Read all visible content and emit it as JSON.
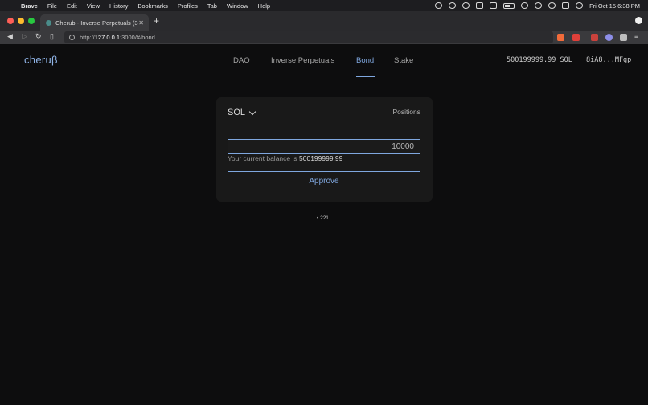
{
  "menubar": {
    "app": "Brave",
    "items": [
      "File",
      "Edit",
      "View",
      "History",
      "Bookmarks",
      "Profiles",
      "Tab",
      "Window",
      "Help"
    ],
    "clock": "Fri Oct 15  6:38 PM"
  },
  "tab": {
    "title": "Cherub - Inverse Perpetuals (3..."
  },
  "toolbar": {
    "url_scheme": "http://",
    "url_host": "127.0.0.1",
    "url_rest": ":3000/#/bond"
  },
  "header": {
    "logo": "cheruβ",
    "nav": [
      "DAO",
      "Inverse Perpetuals",
      "Bond",
      "Stake"
    ],
    "active_nav": "Bond",
    "balance": "500199999.99 SOL",
    "wallet": "8iA8...MFgp"
  },
  "card": {
    "token": "SOL",
    "positions_label": "Positions",
    "amount_value": "10000",
    "balance_prefix": "Your current balance is",
    "balance_value": "500199999.99",
    "approve_label": "Approve"
  },
  "footer": {
    "item": "• 221"
  },
  "colors": {
    "accent": "#7fa7df",
    "background": "#0d0d0e",
    "card": "#191919"
  }
}
